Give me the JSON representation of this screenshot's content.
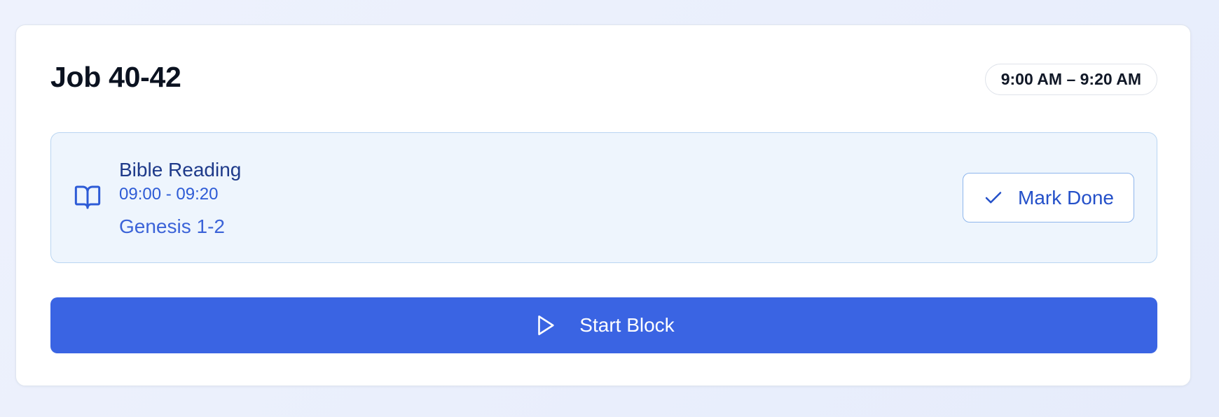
{
  "card": {
    "title": "Job 40-42",
    "time_range": "9:00 AM – 9:20 AM"
  },
  "activity": {
    "icon": "book-open-icon",
    "name": "Bible Reading",
    "time": "09:00 - 09:20",
    "detail": "Genesis 1-2",
    "mark_done_icon": "check-icon",
    "mark_done_label": "Mark Done"
  },
  "start_block": {
    "icon": "play-icon",
    "label": "Start Block"
  },
  "colors": {
    "accent": "#3a64e3",
    "activity_bg": "#eef5fd",
    "activity_border": "#b9d5f2",
    "activity_text": "#1e3a8a"
  }
}
